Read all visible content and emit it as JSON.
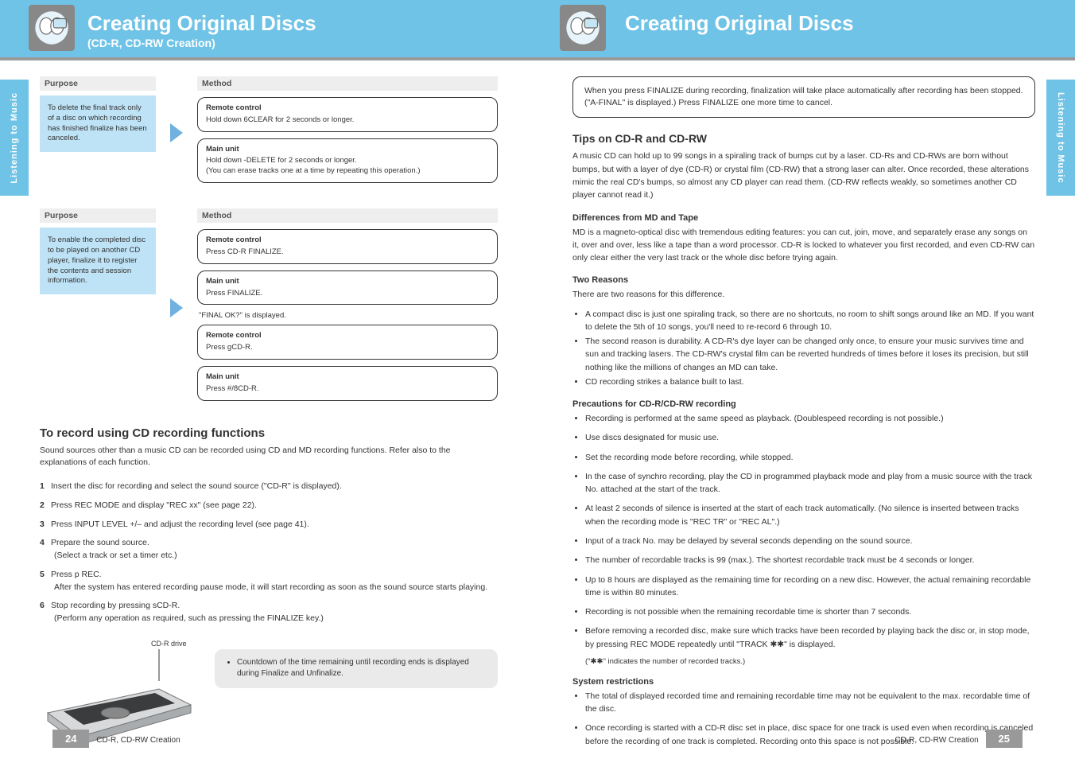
{
  "sidetab_left": "Listening to Music",
  "sidetab_right": "Listening to Music",
  "left": {
    "title": "Creating Original Discs",
    "subtitle": "(CD-R, CD-RW Creation)",
    "purpose1": {
      "label": "Purpose",
      "text": "To delete the final track only of a disc on which recording has finished finalize has been canceled."
    },
    "method1": {
      "label": "Method",
      "a_label": "Remote control",
      "a_text": "Hold down 6CLEAR for 2 seconds or longer.",
      "b_label": "Main unit",
      "b_text_1": "Hold down -DELETE for 2 seconds or longer.",
      "b_text_2": "(You can erase tracks one at a time by repeating this operation.)"
    },
    "purpose2": {
      "label": "Purpose",
      "text": "To enable the completed disc to be played on another CD player, finalize it to register the contents and session information."
    },
    "method2": {
      "label": "Method",
      "a_label": "Remote control",
      "a_text": "Press CD-R FINALIZE.",
      "b_label": "Main unit",
      "b_text": "Press FINALIZE.",
      "common_text": "\"FINAL OK?\" is displayed.",
      "c_label": "Remote control",
      "c_text": "Press gCD-R.",
      "d_label": "Main unit",
      "d_text": "Press #/8CD-R."
    },
    "cd_heading": "To record using CD recording functions",
    "cd_intro": "Sound sources other than a music CD can be recorded using CD and MD recording functions. Refer also to the explanations of each function.",
    "cd_items": [
      {
        "num": "1",
        "text": "Insert the disc for recording and select the sound source (\"CD-R\" is displayed)."
      },
      {
        "num": "2",
        "text": "Press REC MODE and display \"REC xx\" (see page 22)."
      },
      {
        "num": "3",
        "text": "Press INPUT LEVEL +/– and adjust the recording level (see page 41)."
      },
      {
        "num": "4",
        "text": "Prepare the sound source.",
        "sub": "(Select a track or set a timer etc.)"
      },
      {
        "num": "5",
        "text": "Press p REC.",
        "sub": "After the system has entered recording pause mode, it will start recording as soon as the sound source starts playing."
      },
      {
        "num": "6",
        "text": "Stop recording by pressing sCD-R.",
        "sub": "(Perform any operation as required, such as pressing the FINALIZE key.)"
      }
    ],
    "device_label": "CD-R drive",
    "note": "Countdown of the time remaining until recording ends is displayed during Finalize and Unfinalize.",
    "pagenum_box": "24",
    "pagenum_text": "CD-R, CD-RW Creation"
  },
  "right": {
    "title": "Creating Original Discs",
    "box": "When you press FINALIZE during recording, finalization will take place automatically after recording has been stopped. (\"A-FINAL\" is displayed.) Press FINALIZE one more time to cancel.",
    "heading": "Tips on CD-R and CD-RW",
    "p1": "A music CD can hold up to 99 songs in a spiraling track of bumps cut by a laser. CD-Rs and CD-RWs are born without bumps, but with a layer of dye (CD-R) or crystal film (CD-RW) that a strong laser can alter. Once recorded, these alterations mimic the real CD's bumps, so almost any CD player can read them. (CD-RW reflects weakly, so sometimes another CD player cannot read it.)",
    "sub1": "Differences from MD and Tape",
    "p2": "MD is a magneto-optical disc with tremendous editing features: you can cut, join, move, and separately erase any songs on it, over and over, less like a tape than a word processor. CD-R is locked to whatever you first recorded, and even CD-RW can only clear either the very last track or the whole disc before trying again.",
    "sub2": "Two Reasons",
    "p3_intro": "There are two reasons for this difference.",
    "p3_list": [
      "A compact disc is just one spiraling track, so there are no shortcuts, no room to shift songs around like an MD. If you want to delete the 5th of 10 songs, you'll need to re-record 6 through 10.",
      "The second reason is durability. A CD-R's dye layer can be changed only once, to ensure your music survives time and sun and tracking lasers. The CD-RW's crystal film can be reverted hundreds of times before it loses its precision, but still nothing like the millions of changes an MD can take.",
      "CD recording strikes a balance built to last."
    ],
    "sub3": "Precautions for CD-R/CD-RW recording",
    "prec": [
      "Recording is performed at the same speed as playback. (Doublespeed recording is not possible.)",
      "Use discs designated for music use.",
      "Set the recording mode before recording, while stopped.",
      "In the case of synchro recording, play the CD in programmed playback mode and play from a music source with the track No. attached at the start of the track.",
      "At least 2 seconds of silence is inserted at the start of each track automatically. (No silence is inserted between tracks when the recording mode is \"REC TR\" or \"REC AL\".)",
      "Input of a track No. may be delayed by several seconds depending on the sound source.",
      "The number of recordable tracks is 99 (max.). The shortest recordable track must be 4 seconds or longer.",
      "Up to 8 hours are displayed as the remaining time for recording on a new disc. However, the actual remaining recordable time is within 80 minutes.",
      "Recording is not possible when the remaining recordable time is shorter than 7 seconds.",
      "Before removing a recorded disc, make sure which tracks have been recorded by playing back the disc or, in stop mode, by pressing REC MODE repeatedly until \"TRACK ✱✱\" is displayed."
    ],
    "note_asterisk": "(\"✱✱\" indicates the number of recorded tracks.)",
    "system_restrict_h": "System restrictions",
    "system_restrict": [
      "The total of displayed recorded time and remaining recordable time may not be equivalent to the max. recordable time of the disc.",
      "Once recording is started with a CD-R disc set in place, disc space for one track is used even when recording is canceled before the recording of one track is completed. Recording onto this space is not possible."
    ],
    "pagenum_box": "25",
    "pagenum_text": "CD-R, CD-RW Creation"
  }
}
